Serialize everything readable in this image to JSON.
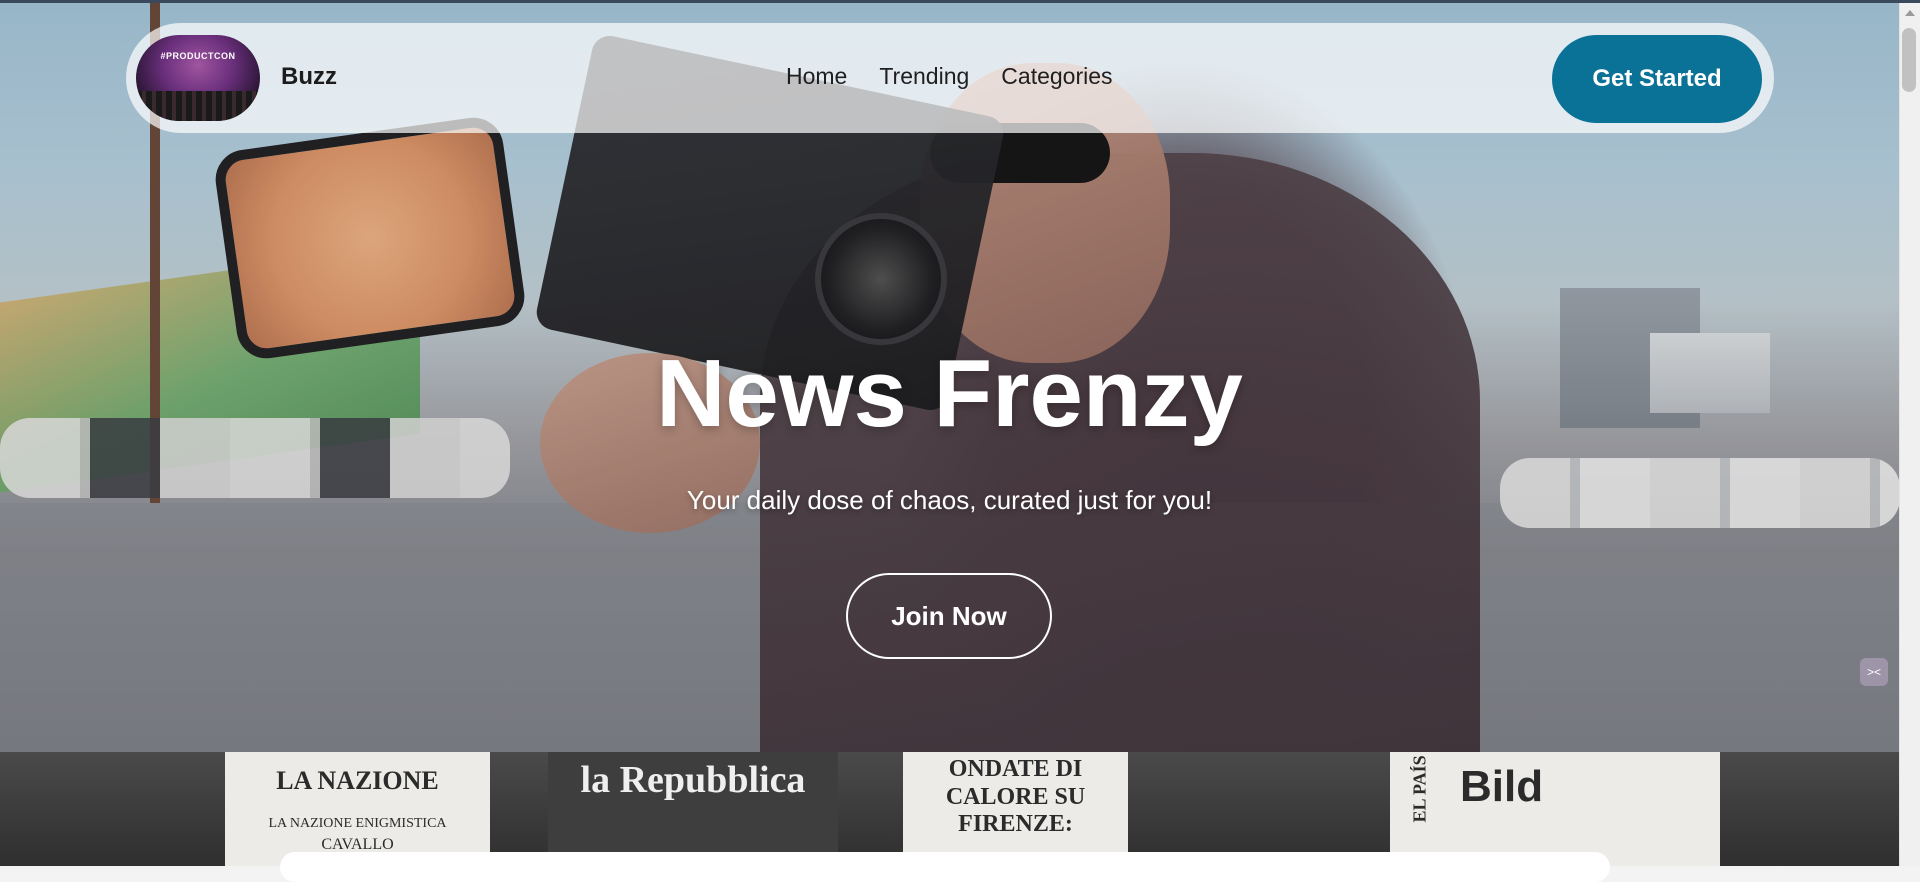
{
  "header": {
    "brand": "Buzz",
    "logo_text": "#PRODUCTCON",
    "nav": [
      "Home",
      "Trending",
      "Categories"
    ],
    "cta_label": "Get Started"
  },
  "hero": {
    "title": "News Frenzy",
    "subtitle": "Your daily dose of chaos, curated just for you!",
    "button_label": "Join Now"
  },
  "newspapers": [
    {
      "masthead": "LA NAZIONE",
      "line": "LA NAZIONE ENIGMISTICA",
      "sub": "CAVALLO"
    },
    {
      "masthead": "la Repubblica"
    },
    {
      "masthead": "ONDATE DI CALORE SU FIRENZE:"
    },
    {
      "masthead": "EL PAÍS"
    },
    {
      "masthead": "Bild"
    }
  ],
  "colors": {
    "accent": "#0a7297",
    "hero_text": "#ffffff"
  }
}
